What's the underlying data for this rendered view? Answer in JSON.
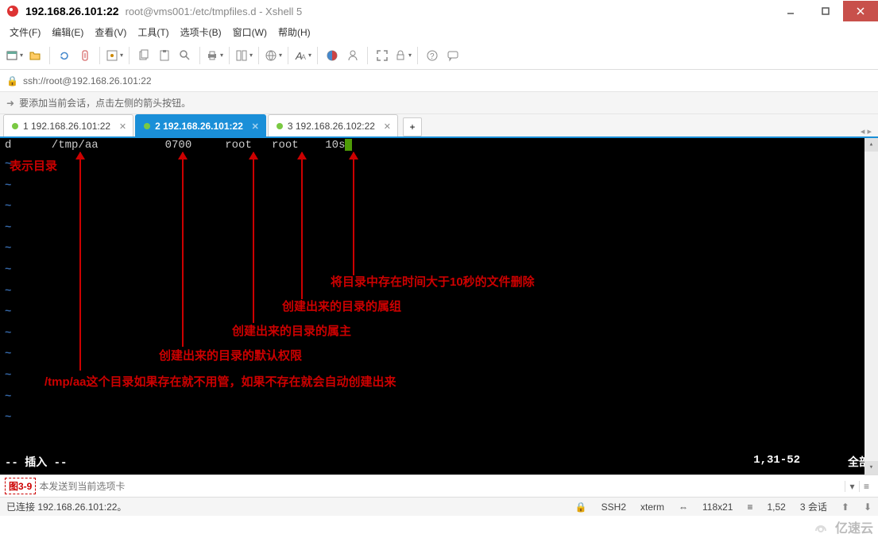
{
  "titlebar": {
    "main": "192.168.26.101:22",
    "sub": "root@vms001:/etc/tmpfiles.d - Xshell 5"
  },
  "menu": {
    "file": "文件(F)",
    "edit": "编辑(E)",
    "view": "查看(V)",
    "tools": "工具(T)",
    "tab": "选项卡(B)",
    "window": "窗口(W)",
    "help": "帮助(H)"
  },
  "address": {
    "url": "ssh://root@192.168.26.101:22"
  },
  "hint": {
    "text": "要添加当前会话，点击左侧的箭头按钮。"
  },
  "tabs": {
    "t1": "1 192.168.26.101:22",
    "t2": "2 192.168.26.101:22",
    "t3": "3 192.168.26.102:22",
    "add": "+",
    "nav": "◂ ▸"
  },
  "terminal": {
    "line": "d      /tmp/aa          0700     root   root    10s",
    "tildes": "~\n~\n~\n~\n~\n~\n~\n~\n~\n~\n~\n~\n~",
    "mode": "-- 插入 --",
    "pos": "1,31-52",
    "pct": "全部"
  },
  "annot": {
    "a1": "表示目录",
    "a2": "/tmp/aa这个目录如果存在就不用管，如果不存在就会自动创建出来",
    "a3": "创建出来的目录的默认权限",
    "a4": "创建出来的目录的属主",
    "a5": "创建出来的目录的属组",
    "a6": "将目录中存在时间大于10秒的文件删除"
  },
  "inputbar": {
    "fig": "图3-9",
    "placeholder": "本发送到当前选项卡"
  },
  "status": {
    "conn": "已连接 192.168.26.101:22。",
    "ssh": "SSH2",
    "term": "xterm",
    "size": "118x21",
    "rows": "1,52",
    "sessions": "3 会话"
  },
  "watermark": "亿速云",
  "icons": {
    "lock": "🔒",
    "arrow": "➜",
    "sizeicon": "⇔",
    "rowicon": "≡",
    "up": "▴",
    "dn": "▾",
    "sessup": "⬆",
    "sessdn": "⬇"
  }
}
